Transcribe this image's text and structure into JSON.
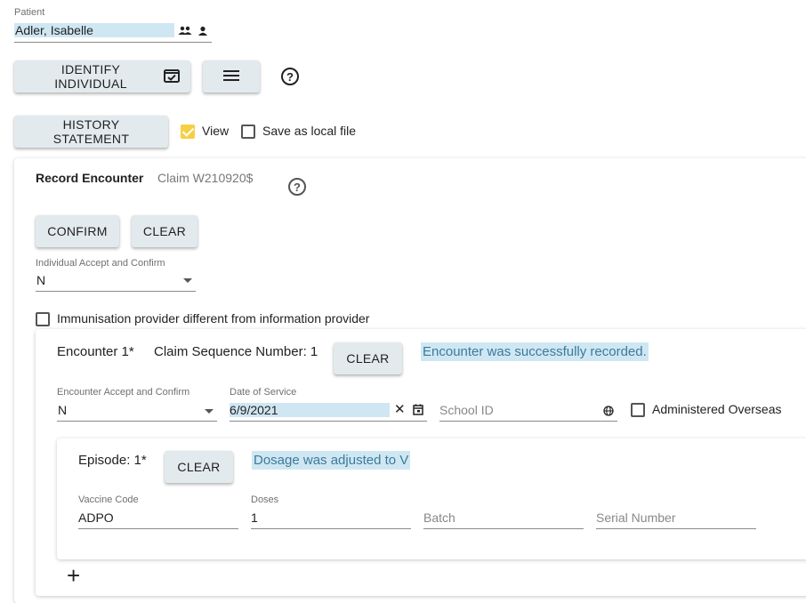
{
  "patient": {
    "label": "Patient",
    "name": "Adler, Isabelle",
    "icons": [
      "people-icon",
      "person-icon"
    ]
  },
  "toolbar": {
    "identify_label": "IDENTIFY INDIVIDUAL",
    "menu_icon": "menu-icon",
    "help_icon": "help-circle-icon",
    "help_glyph": "?"
  },
  "history": {
    "button_label": "HISTORY STATEMENT",
    "view_label": "View",
    "view_checked": true,
    "save_local_label": "Save as local file",
    "save_local_checked": false
  },
  "record": {
    "title": "Record Encounter",
    "claim": "Claim W210920$",
    "help_glyph": "?",
    "confirm_label": "CONFIRM",
    "clear_label": "CLEAR",
    "accept_label": "Individual Accept and Confirm",
    "accept_value": "N",
    "immunisation_label": "Immunisation provider different from information provider",
    "immunisation_checked": false
  },
  "encounter": {
    "title": "Encounter 1*",
    "claim_seq": "Claim Sequence Number: 1",
    "clear_label": "CLEAR",
    "message": "Encounter was successfully recorded.",
    "accept_label": "Encounter Accept and Confirm",
    "accept_value": "N",
    "date_label": "Date of Service",
    "date_value": "6/9/2021",
    "school_placeholder": "School ID",
    "overseas_label": "Administered Overseas",
    "overseas_checked": false
  },
  "episode": {
    "title": "Episode: 1*",
    "clear_label": "CLEAR",
    "message": "Dosage was adjusted to V",
    "vaccine_label": "Vaccine Code",
    "vaccine_value": "ADPO",
    "doses_label": "Doses",
    "doses_value": "1",
    "batch_placeholder": "Batch",
    "serial_placeholder": "Serial Number"
  },
  "add_glyph": "+",
  "colors": {
    "button_bg": "#e3eaee",
    "highlight": "#cfe7f2",
    "message_text": "#3d7a9c",
    "checkbox_checked": "#f6cf45"
  }
}
